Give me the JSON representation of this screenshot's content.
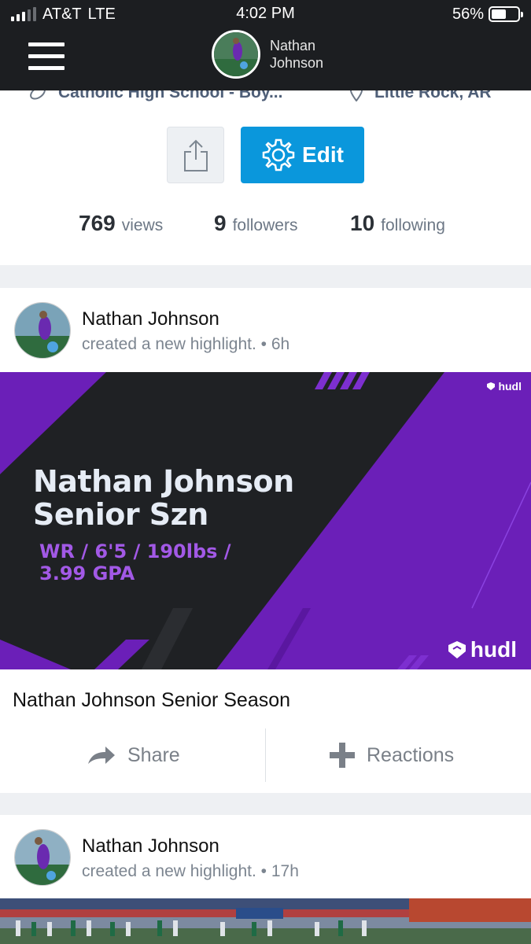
{
  "status_bar": {
    "carrier": "AT&T",
    "network": "LTE",
    "time": "4:02 PM",
    "battery": "56%",
    "battery_level": 0.56
  },
  "nav": {
    "user_name": "Nathan Johnson"
  },
  "profile": {
    "school": "Catholic High School - Boy...",
    "location": "Little Rock, AR",
    "edit_label": "Edit",
    "stats": [
      {
        "value": "769",
        "label": "views"
      },
      {
        "value": "9",
        "label": "followers"
      },
      {
        "value": "10",
        "label": "following"
      }
    ]
  },
  "feed": [
    {
      "author": "Nathan Johnson",
      "subtitle": "created a new highlight. • 6h",
      "video": {
        "title_line1": "Nathan Johnson",
        "title_line2": "Senior Szn",
        "stats_line": "WR / 6'5 / 190lbs / 3.99 GPA",
        "brand": "hudl"
      },
      "caption": "Nathan Johnson Senior Season",
      "actions": {
        "share": "Share",
        "reactions": "Reactions"
      }
    },
    {
      "author": "Nathan Johnson",
      "subtitle": "created a new highlight. • 17h"
    }
  ],
  "colors": {
    "accent": "#0a97dc",
    "purple": "#6b1fb8",
    "dark": "#1c1e21"
  }
}
